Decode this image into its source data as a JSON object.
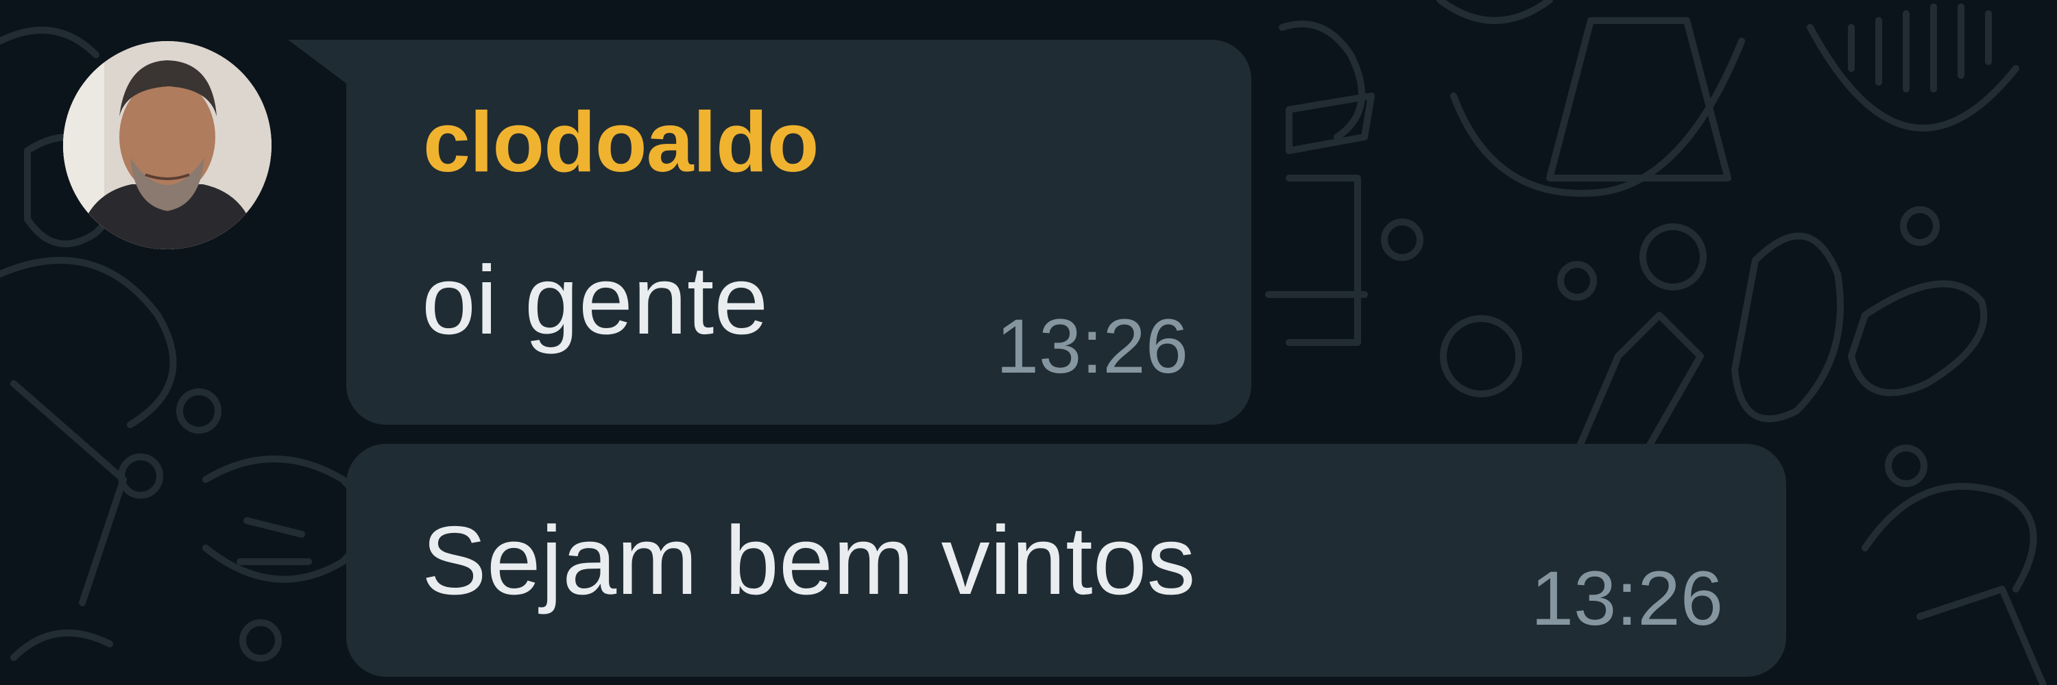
{
  "chat": {
    "messages": [
      {
        "sender": "clodoaldo",
        "text": "oi gente",
        "time": "13:26",
        "sender_color": "#f0b330"
      },
      {
        "text": "Sejam bem vintos",
        "time": "13:26"
      }
    ],
    "avatar_icon": "contact-photo",
    "bubble_color": "#202c33",
    "background_color": "#0b141a",
    "text_color": "#e9edef",
    "time_color": "#8696a0"
  }
}
